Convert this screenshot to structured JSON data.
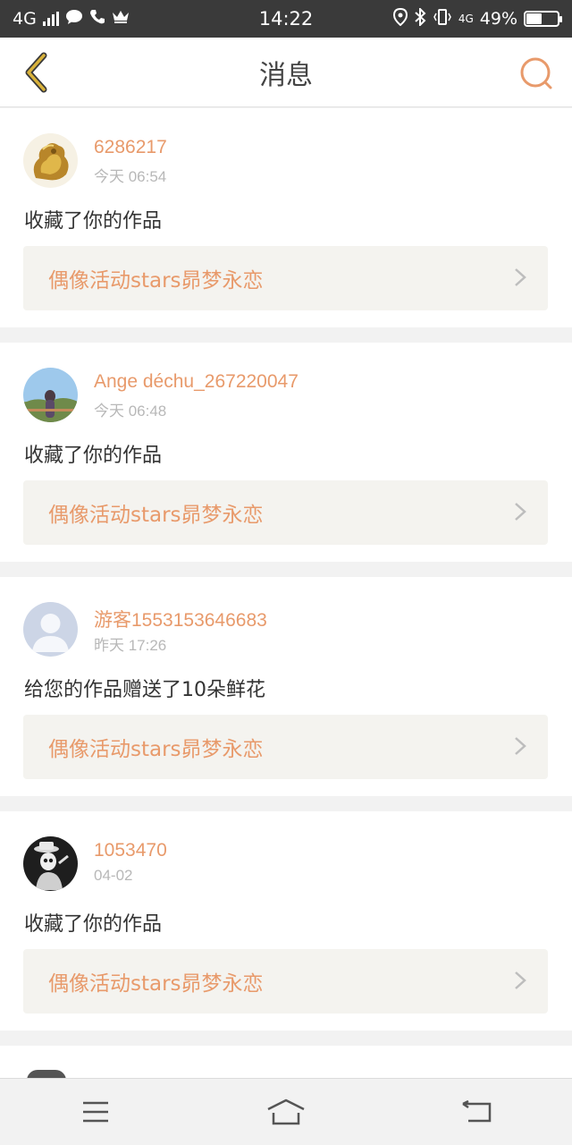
{
  "status_bar": {
    "network": "4G",
    "time": "14:22",
    "net2": "4G",
    "battery": "49%",
    "battery_level": 0.49
  },
  "nav": {
    "title": "消息"
  },
  "messages": [
    {
      "username": "6286217",
      "time": "今天 06:54",
      "action": "收藏了你的作品",
      "work": "偶像活动stars昴梦永恋",
      "avatar": "golden-dragon-avatar"
    },
    {
      "username": "Ange déchu_267220047",
      "time": "今天 06:48",
      "action": "收藏了你的作品",
      "work": "偶像活动stars昴梦永恋",
      "avatar": "girl-photo-avatar"
    },
    {
      "username": "游客1553153646683",
      "time": "昨天 17:26",
      "action": "给您的作品赠送了10朵鲜花",
      "work": "偶像活动stars昴梦永恋",
      "avatar": "default-person-avatar"
    },
    {
      "username": "1053470",
      "time": "04-02",
      "action": "收藏了你的作品",
      "work": "偶像活动stars昴梦永恋",
      "avatar": "skeleton-hat-avatar"
    }
  ],
  "colors": {
    "accent": "#e89a6b",
    "status_bar": "#3a3a3a",
    "card_link_bg": "#f4f3ef",
    "back_icon": "#d9b23a"
  }
}
